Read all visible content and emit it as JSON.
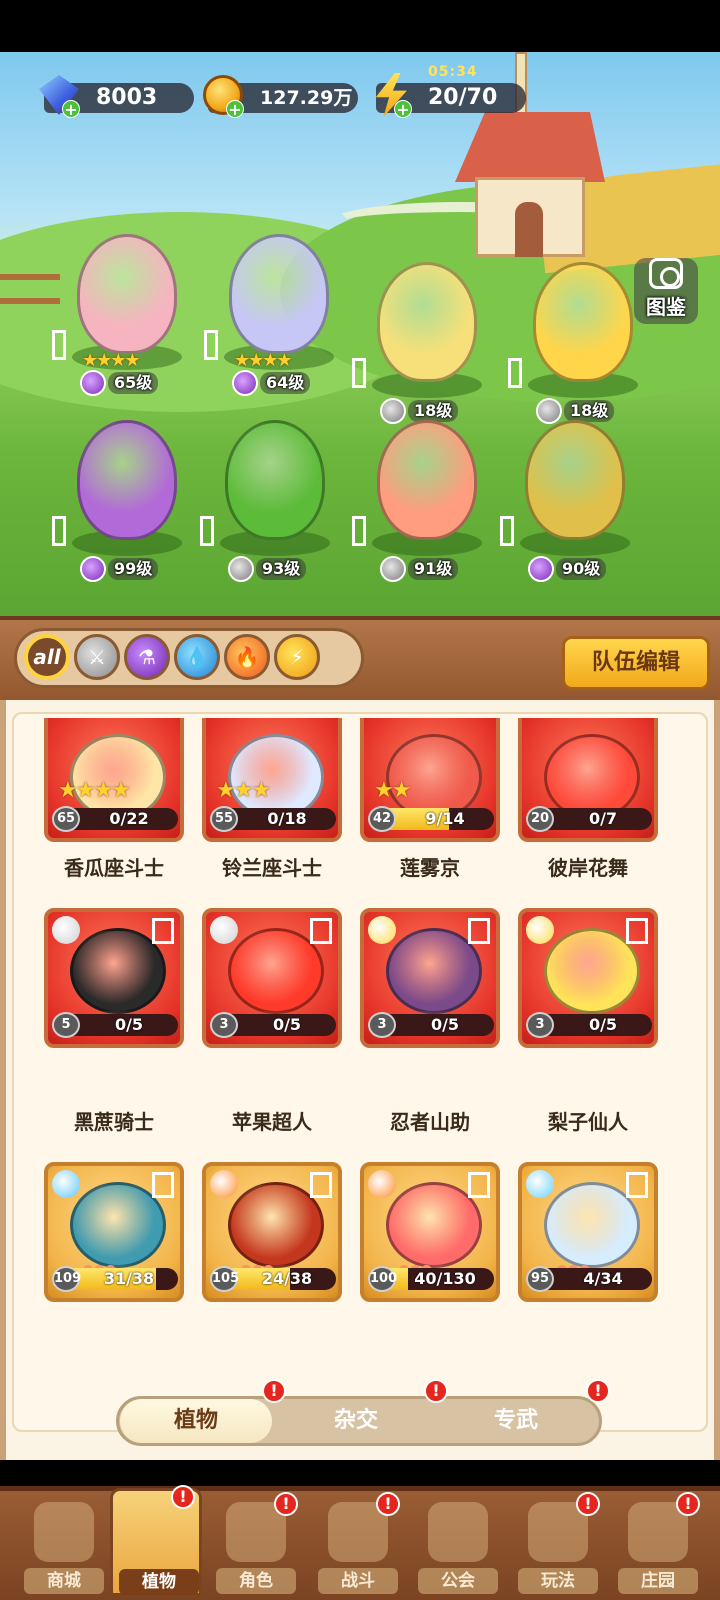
{
  "resources": {
    "gems": "8003",
    "gold": "127.29万",
    "energy": "20/70",
    "energy_timer": "05:34"
  },
  "codex_label": "图鉴",
  "field_heroes": [
    {
      "level": "65级",
      "stars": "★★★★",
      "type": "potion"
    },
    {
      "level": "64级",
      "stars": "★★★★",
      "type": "potion"
    },
    {
      "level": "18级",
      "stars": "",
      "type": "sword"
    },
    {
      "level": "18级",
      "stars": "",
      "type": "sword"
    },
    {
      "level": "99级",
      "stars": "",
      "type": "potion"
    },
    {
      "level": "93级",
      "stars": "",
      "type": "sword"
    },
    {
      "level": "91级",
      "stars": "",
      "type": "sword"
    },
    {
      "level": "90级",
      "stars": "",
      "type": "potion"
    }
  ],
  "filters": {
    "all_label": "all",
    "icons": [
      "sword-icon",
      "potion-icon",
      "water-drop-icon",
      "fire-icon",
      "lightning-icon"
    ]
  },
  "team_edit_label": "队伍编辑",
  "cards": [
    {
      "name": "香瓜座斗士",
      "level": "65",
      "progress": "0/22",
      "fill": 0,
      "stars": "★★★★",
      "color": "red"
    },
    {
      "name": "铃兰座斗士",
      "level": "55",
      "progress": "0/18",
      "fill": 0,
      "stars": "★★★",
      "color": "red"
    },
    {
      "name": "莲雾京",
      "level": "42",
      "progress": "9/14",
      "fill": 0.64,
      "stars": "★★",
      "color": "red"
    },
    {
      "name": "彼岸花舞",
      "level": "20",
      "progress": "0/7",
      "fill": 0,
      "stars": "",
      "color": "red"
    },
    {
      "name": "黑蔗骑士",
      "level": "5",
      "progress": "0/5",
      "fill": 0,
      "stars": "",
      "color": "red"
    },
    {
      "name": "苹果超人",
      "level": "3",
      "progress": "0/5",
      "fill": 0,
      "stars": "",
      "color": "red"
    },
    {
      "name": "忍者山助",
      "level": "3",
      "progress": "0/5",
      "fill": 0,
      "stars": "",
      "color": "red"
    },
    {
      "name": "梨子仙人",
      "level": "3",
      "progress": "0/5",
      "fill": 0,
      "stars": "",
      "color": "red"
    },
    {
      "name": "",
      "level": "109",
      "progress": "31/38",
      "fill": 0.82,
      "stars": "",
      "color": "gold"
    },
    {
      "name": "",
      "level": "105",
      "progress": "24/38",
      "fill": 0.63,
      "stars": "",
      "color": "gold"
    },
    {
      "name": "",
      "level": "100",
      "progress": "40/130",
      "fill": 0.31,
      "stars": "",
      "color": "gold"
    },
    {
      "name": "",
      "level": "95",
      "progress": "4/34",
      "fill": 0.12,
      "stars": "",
      "color": "gold"
    }
  ],
  "segments": [
    "植物",
    "杂交",
    "专武"
  ],
  "badge_symbol": "!",
  "nav": [
    "商城",
    "植物",
    "角色",
    "战斗",
    "公会",
    "玩法",
    "庄园"
  ],
  "colors": {
    "accent_gold": "#f3a81c",
    "wood": "#93582f",
    "card_red": "#e6342a",
    "card_gold": "#f2b449",
    "badge_red": "#e4261e"
  }
}
